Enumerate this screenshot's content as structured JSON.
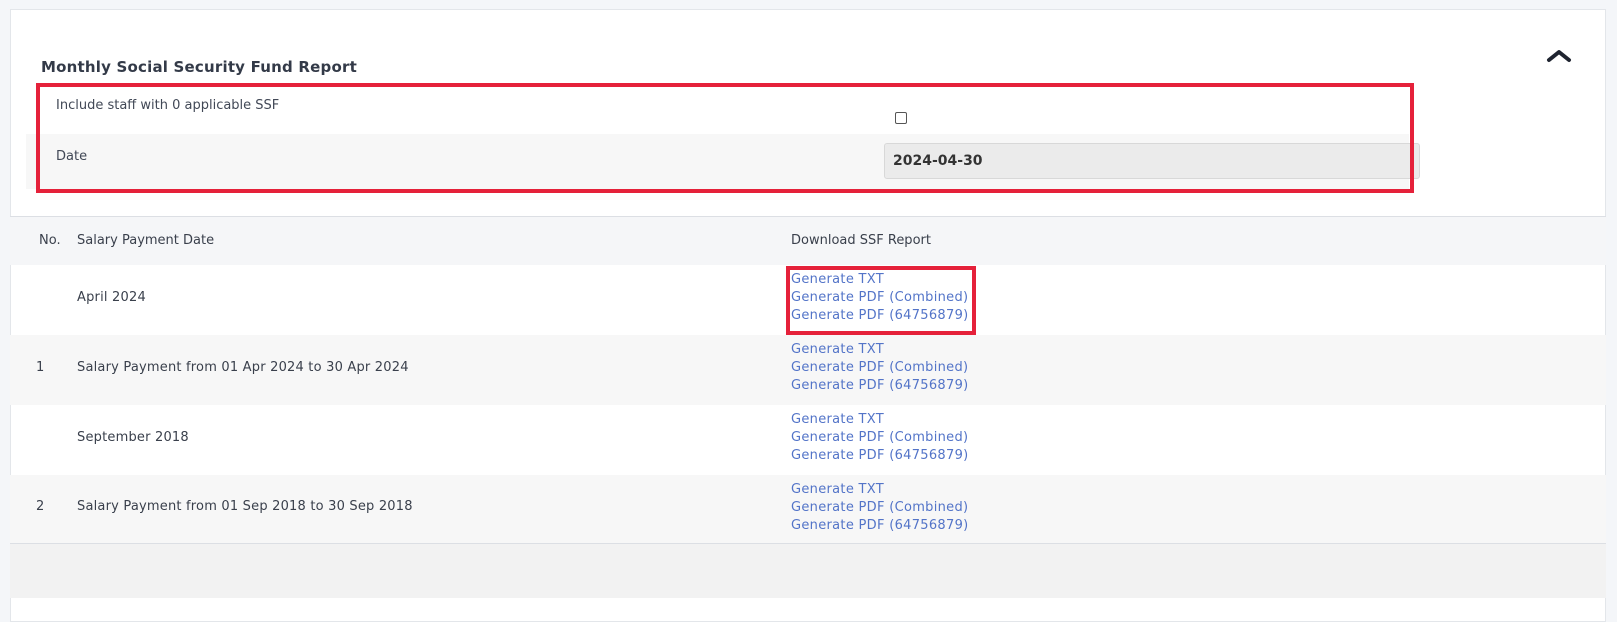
{
  "report": {
    "title": "Monthly Social Security Fund Report",
    "collapse_icon": "chevron-up-icon"
  },
  "filters": {
    "include_zero_label": "Include staff with 0 applicable SSF",
    "include_zero_checked": false,
    "date_label": "Date",
    "date_value": "2024-04-30"
  },
  "table": {
    "headers": {
      "no": "No.",
      "date": "Salary Payment Date",
      "download": "Download SSF Report"
    },
    "rows": [
      {
        "no": "",
        "date": "April 2024",
        "links": [
          "Generate TXT",
          "Generate PDF (Combined)",
          "Generate PDF (64756879)"
        ]
      },
      {
        "no": "1",
        "date": "Salary Payment from 01 Apr 2024 to 30 Apr 2024",
        "links": [
          "Generate TXT",
          "Generate PDF (Combined)",
          "Generate PDF (64756879)"
        ]
      },
      {
        "no": "",
        "date": "September 2018",
        "links": [
          "Generate TXT",
          "Generate PDF (Combined)",
          "Generate PDF (64756879)"
        ]
      },
      {
        "no": "2",
        "date": "Salary Payment from 01 Sep 2018 to 30 Sep 2018",
        "links": [
          "Generate TXT",
          "Generate PDF (Combined)",
          "Generate PDF (64756879)"
        ]
      }
    ]
  },
  "colors": {
    "link": "#5374c8",
    "highlight": "#e5213a",
    "row_alt": "#f7f7f7"
  }
}
